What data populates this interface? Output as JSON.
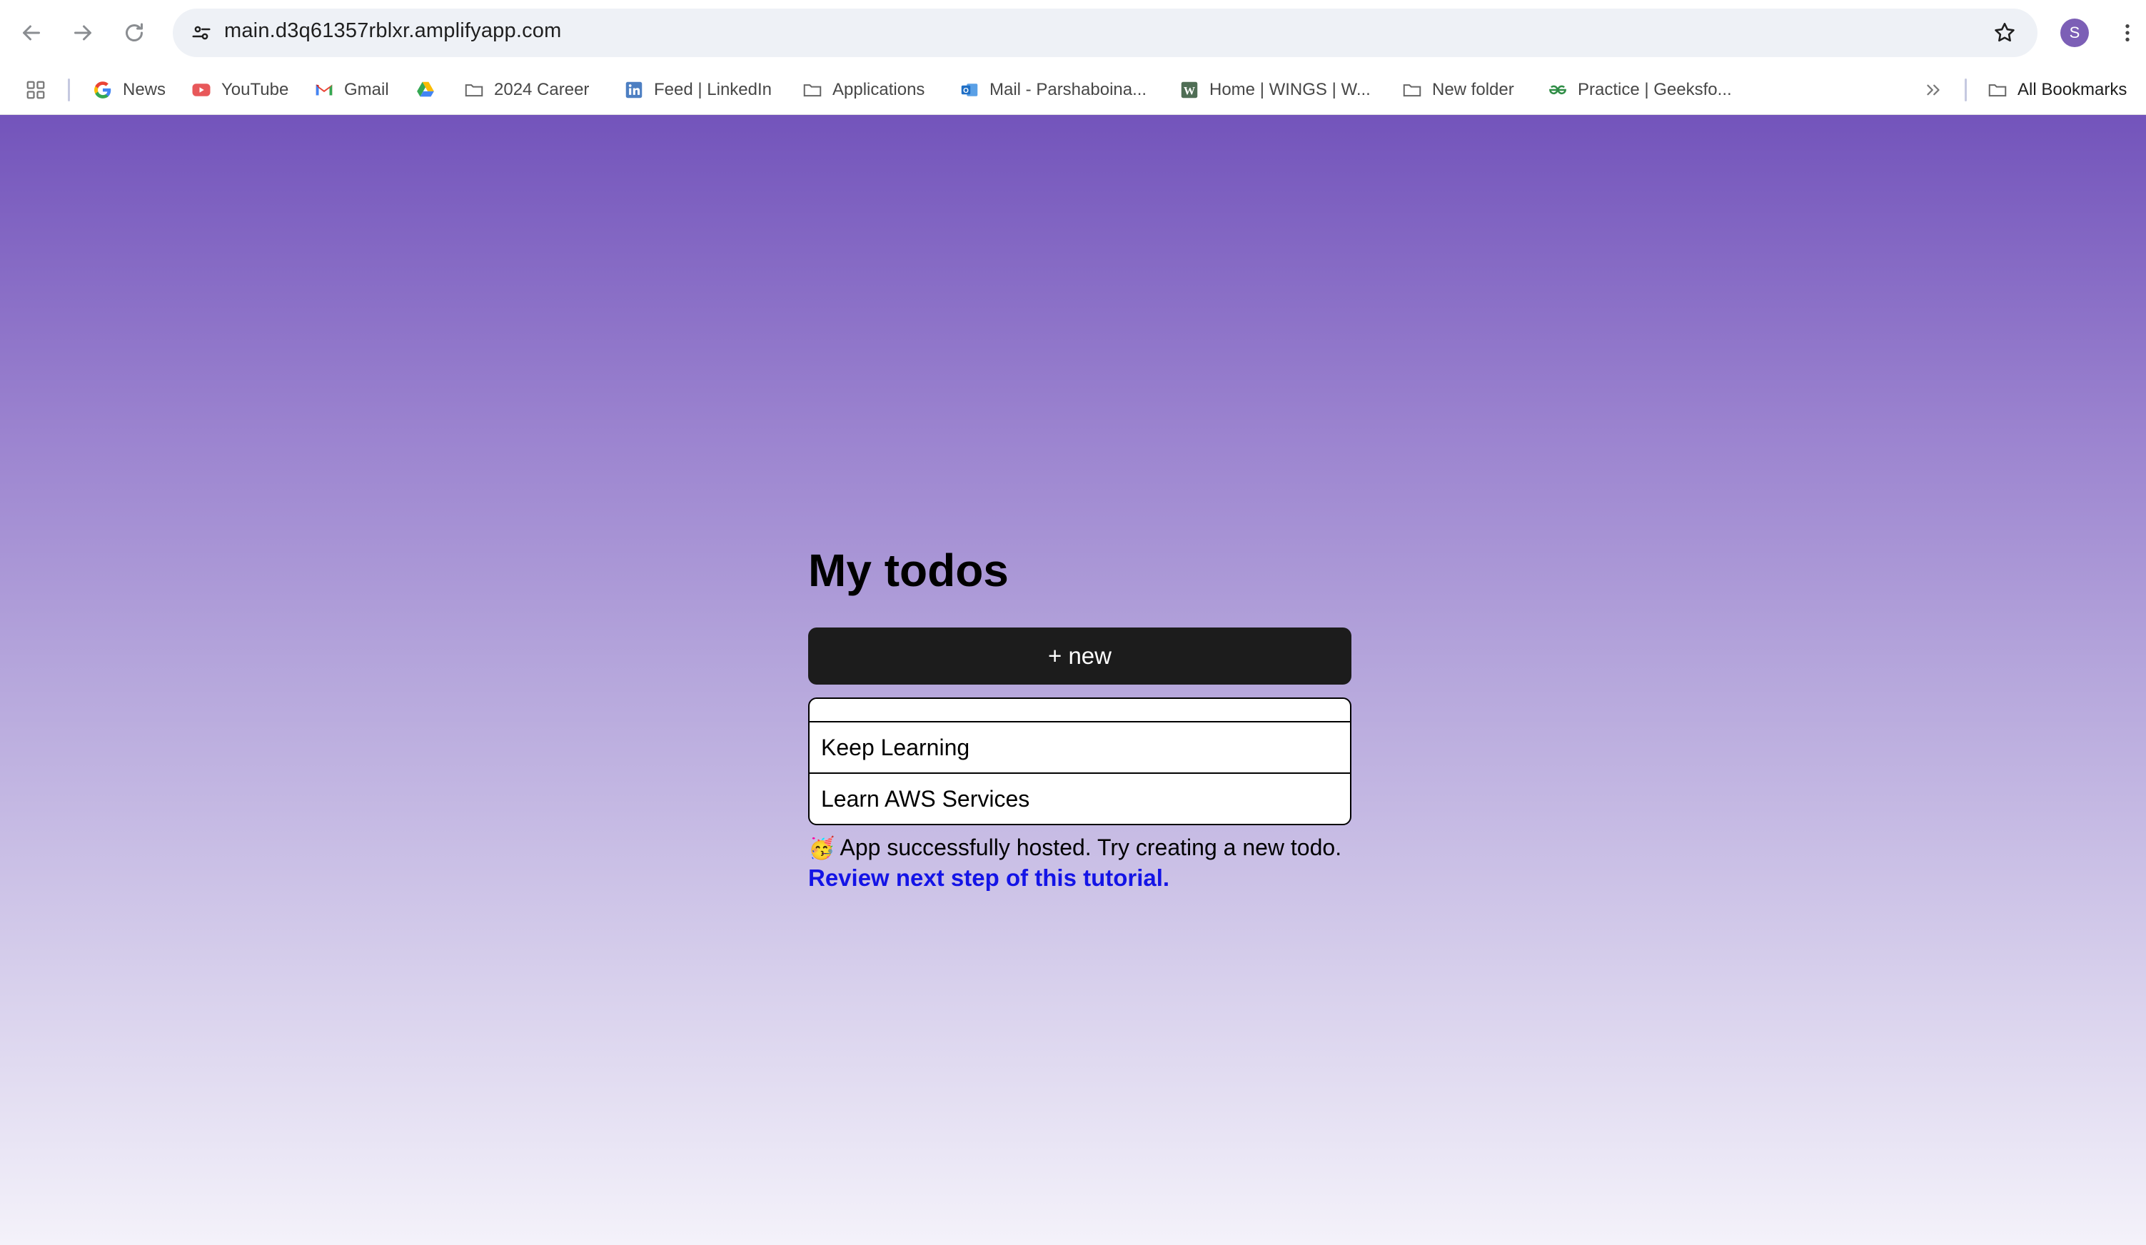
{
  "browser": {
    "url": "main.d3q61357rblxr.amplifyapp.com",
    "profile_initial": "S",
    "bookmarks": [
      {
        "label": "News",
        "icon": "google-icon"
      },
      {
        "label": "YouTube",
        "icon": "youtube-icon"
      },
      {
        "label": "Gmail",
        "icon": "gmail-icon"
      },
      {
        "label": "",
        "icon": "google-drive-icon"
      },
      {
        "label": "2024 Career",
        "icon": "folder-icon"
      },
      {
        "label": "Feed | LinkedIn",
        "icon": "linkedin-icon"
      },
      {
        "label": "Applications",
        "icon": "folder-icon"
      },
      {
        "label": "Mail - Parshaboina...",
        "icon": "outlook-icon"
      },
      {
        "label": "Home | WINGS | W...",
        "icon": "wings-icon"
      },
      {
        "label": "New folder",
        "icon": "folder-icon"
      },
      {
        "label": "Practice | Geeksfo...",
        "icon": "geeksforgeeks-icon"
      }
    ],
    "overflow_icon": "chevron-double-right-icon",
    "all_bookmarks_label": "All Bookmarks"
  },
  "app": {
    "title": "My todos",
    "new_button_label": "+ new",
    "todos": [
      "",
      "Keep Learning",
      "Learn AWS Services"
    ],
    "status_emoji": "🥳",
    "status_text": "App successfully hosted. Try creating a new todo.",
    "tutorial_link": "Review next step of this tutorial."
  },
  "colors": {
    "gradient_top": "#7354bb",
    "gradient_bottom": "#f4f2fa",
    "button_bg": "#1c1c1c",
    "link": "#1414e6",
    "avatar": "#7c5fb6"
  }
}
